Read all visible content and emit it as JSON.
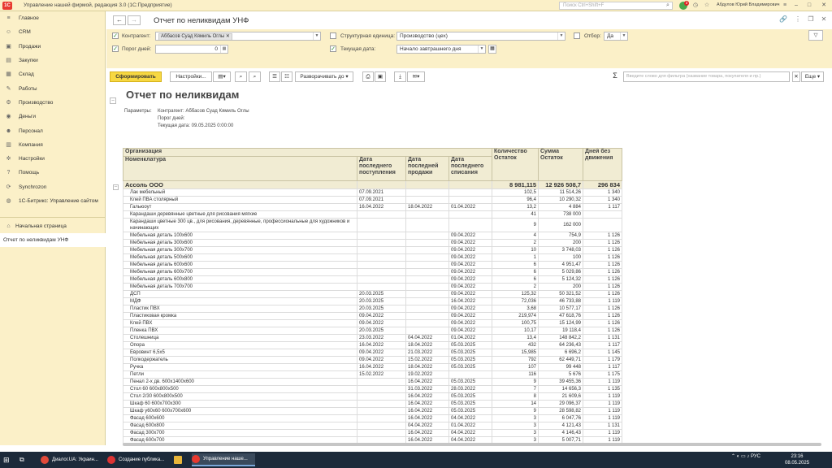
{
  "window": {
    "title": "Управление нашей фирмой, редакция 3.0  (1С:Предприятие)",
    "search_placeholder": "Поиск Ctrl+Shift+F",
    "user": "Абдулов Юрий Владимирович",
    "notif_count": "3",
    "logo": "1С"
  },
  "sidebar": {
    "items": [
      "Главное",
      "CRM",
      "Продажи",
      "Закупки",
      "Склад",
      "Работы",
      "Производство",
      "Деньги",
      "Персонал",
      "Компания",
      "Настройки",
      "Помощь",
      "Synchrozon",
      "1С-Битрикс: Управление сайтом"
    ],
    "home": "Начальная страница",
    "open": "Отчет по неликвидам УНФ"
  },
  "header": {
    "title": "Отчет по неликвидам УНФ"
  },
  "filters": {
    "kontragent_label": "Контрагент:",
    "kontragent_value": "Аббасов Суад Кямиль Оглы",
    "struct_label": "Структурная единица:",
    "struct_value": "Производство (цех)",
    "otbor_label": "Отбор:",
    "otbor_value": "Да",
    "porog_label": "Порог дней:",
    "porog_value": "0",
    "date_label": "Текущая дата:",
    "date_value": "Начало завтрашнего дня"
  },
  "toolbar": {
    "generate": "Сформировать",
    "settings": "Настройки...",
    "expand": "Разворачивать до",
    "more": "Еще",
    "filter_placeholder": "Введите слово для фильтра (название товара, покупателя и пр.)"
  },
  "report": {
    "title": "Отчет по неликвидам",
    "params_label": "Параметры:",
    "param1": "Контрагент: Аббасов Суад Кямиль Оглы",
    "param2": "Порог дней:",
    "param3": "Текущая дата: 09.05.2025 0:00:00",
    "headers": {
      "org": "Организация",
      "nom": "Номенклатура",
      "d1": "Дата последнего поступления",
      "d2": "Дата последней продажи",
      "d3": "Дата последнего списания",
      "qty": "Количество Остаток",
      "sum": "Сумма Остаток",
      "days": "Дней без движения"
    },
    "group": {
      "name": "Ассоль ООО",
      "qty": "8 981,115",
      "sum": "12 926 508,7",
      "days": "296 834"
    },
    "rows": [
      [
        "Лак мебельный",
        "07.09.2021",
        "",
        "",
        "102,5",
        "11 514,26",
        "1 340"
      ],
      [
        "Клей ПВА столярный",
        "07.09.2021",
        "",
        "",
        "96,4",
        "10 290,32",
        "1 340"
      ],
      [
        "Гальюоут",
        "16.04.2022",
        "18.04.2022",
        "01.04.2022",
        "13,2",
        "4 884",
        "1 117"
      ],
      [
        "Карандаши деревянные цветные для рисования мягкие",
        "",
        "",
        "",
        "41",
        "738 000",
        ""
      ],
      [
        "Карандаши цветные 300 цв., для рисования, деревянные, профессиональные для художников и начинающих",
        "",
        "",
        "",
        "9",
        "162 000",
        ""
      ],
      [
        "Мебельная деталь 100х600",
        "",
        "",
        "09.04.2022",
        "4",
        "754,9",
        "1 126"
      ],
      [
        "Мебельная деталь 300х600",
        "",
        "",
        "09.04.2022",
        "2",
        "200",
        "1 126"
      ],
      [
        "Мебельная деталь 300х700",
        "",
        "",
        "09.04.2022",
        "10",
        "3 748,03",
        "1 126"
      ],
      [
        "Мебельная деталь 500х600",
        "",
        "",
        "09.04.2022",
        "1",
        "100",
        "1 126"
      ],
      [
        "Мебельная деталь 600х600",
        "",
        "",
        "09.04.2022",
        "6",
        "4 951,47",
        "1 126"
      ],
      [
        "Мебельная деталь 600х700",
        "",
        "",
        "09.04.2022",
        "6",
        "5 029,86",
        "1 126"
      ],
      [
        "Мебельная деталь 600х800",
        "",
        "",
        "09.04.2022",
        "6",
        "5 124,32",
        "1 126"
      ],
      [
        "Мебельная деталь 700х700",
        "",
        "",
        "09.04.2022",
        "2",
        "200",
        "1 126"
      ],
      [
        "ДСП",
        "20.03.2025",
        "",
        "09.04.2022",
        "125,32",
        "50 321,52",
        "1 126"
      ],
      [
        "МДФ",
        "20.03.2025",
        "",
        "16.04.2022",
        "72,036",
        "46 733,88",
        "1 119"
      ],
      [
        "Пластик ПВХ",
        "20.03.2025",
        "",
        "09.04.2022",
        "3,68",
        "10 577,17",
        "1 126"
      ],
      [
        "Пластиковая кромка",
        "09.04.2022",
        "",
        "09.04.2022",
        "219,974",
        "47 618,76",
        "1 126"
      ],
      [
        "Клей ПВХ",
        "09.04.2022",
        "",
        "09.04.2022",
        "100,75",
        "15 124,99",
        "1 126"
      ],
      [
        "Пленка ПВХ",
        "20.03.2025",
        "",
        "09.04.2022",
        "10,17",
        "19 118,4",
        "1 126"
      ],
      [
        "Столешница",
        "23.03.2022",
        "04.04.2022",
        "01.04.2022",
        "13,4",
        "148 842,2",
        "1 131"
      ],
      [
        "Опора",
        "16.04.2022",
        "18.04.2022",
        "05.03.2025",
        "432",
        "64 236,43",
        "1 117"
      ],
      [
        "Евровинт 6,5х5",
        "09.04.2022",
        "21.03.2022",
        "05.03.2025",
        "15,985",
        "6 696,2",
        "1 145"
      ],
      [
        "Полкодержатель",
        "09.04.2022",
        "15.02.2022",
        "05.03.2025",
        "792",
        "62 449,71",
        "1 179"
      ],
      [
        "Ручка",
        "16.04.2022",
        "18.04.2022",
        "05.03.2025",
        "107",
        "99 448",
        "1 117"
      ],
      [
        "Петли",
        "15.02.2022",
        "19.02.2022",
        "",
        "116",
        "5 676",
        "1 175"
      ],
      [
        "Пенал 2-х дв. 600х1400х600",
        "",
        "16.04.2022",
        "05.03.2025",
        "9",
        "39 455,36",
        "1 119"
      ],
      [
        "Стол 60 600х800х500",
        "",
        "31.03.2022",
        "28.03.2022",
        "7",
        "14 656,3",
        "1 135"
      ],
      [
        "Стол 2/30 600х800х500",
        "",
        "16.04.2022",
        "05.03.2025",
        "8",
        "21 609,6",
        "1 119"
      ],
      [
        "Шкаф 60 600х700х300",
        "",
        "16.04.2022",
        "05.03.2025",
        "14",
        "29 096,37",
        "1 119"
      ],
      [
        "Шкаф у60х60 600х700х600",
        "",
        "16.04.2022",
        "05.03.2025",
        "9",
        "28 598,82",
        "1 119"
      ],
      [
        "Фасад 600х600",
        "",
        "16.04.2022",
        "04.04.2022",
        "3",
        "6 047,76",
        "1 119"
      ],
      [
        "Фасад 600х800",
        "",
        "04.04.2022",
        "01.04.2022",
        "3",
        "4 121,43",
        "1 131"
      ],
      [
        "Фасад 300х700",
        "",
        "16.04.2022",
        "04.04.2022",
        "3",
        "4 146,43",
        "1 119"
      ],
      [
        "Фасад 600х700",
        "",
        "16.04.2022",
        "04.04.2022",
        "3",
        "5 007,71",
        "1 119"
      ]
    ]
  },
  "taskbar": {
    "items": [
      "Диалог.UA: Украин...",
      "Создание публика...",
      "",
      "Управление нашe..."
    ],
    "lang": "РУС",
    "time": "23:16",
    "date": "08.05.2025"
  }
}
